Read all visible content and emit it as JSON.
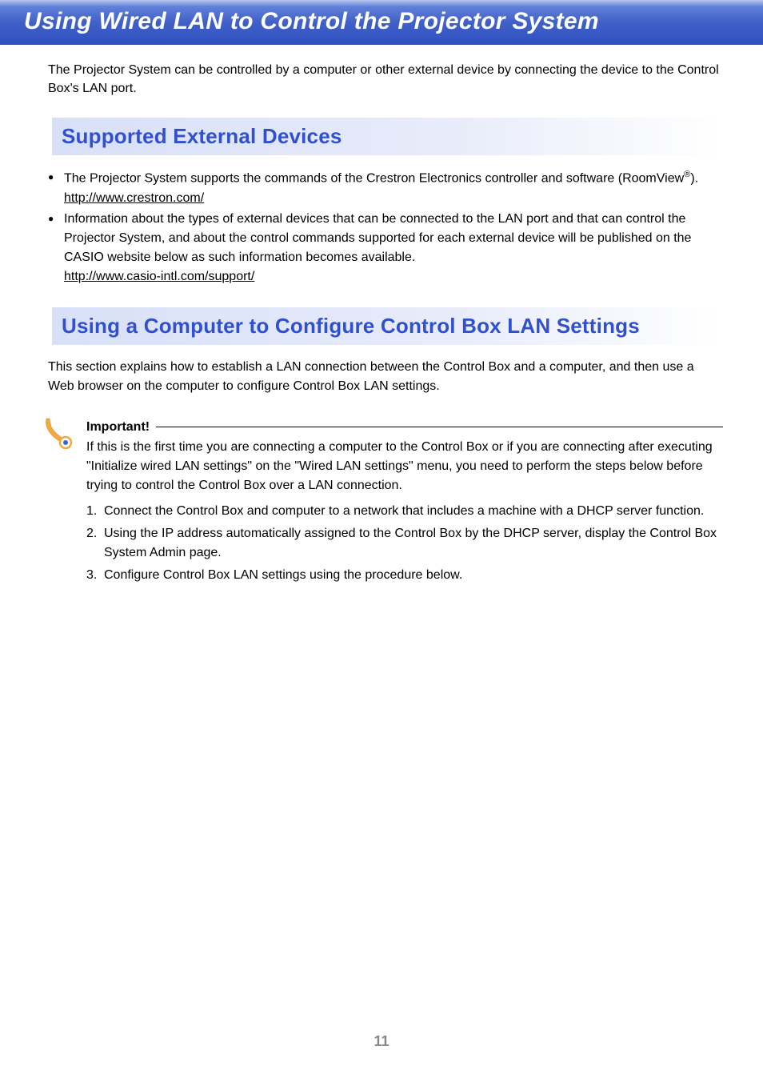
{
  "banner": {
    "title": "Using Wired LAN to Control the Projector System"
  },
  "intro": "The Projector System can be controlled by a computer or other external device by connecting the device to the Control Box's LAN port.",
  "section1": {
    "heading": "Supported External Devices",
    "bullet1_prefix": "The Projector System supports the commands of the Crestron Electronics controller and software (RoomView",
    "bullet1_suffix": ").",
    "bullet1_link": "http://www.crestron.com/",
    "bullet2_text": "Information about the types of external devices that can be connected to the LAN port and that can control the Projector System, and about the control commands supported for each external device will be published on the CASIO website below as such information becomes available.",
    "bullet2_link": "http://www.casio-intl.com/support/"
  },
  "section2": {
    "heading": "Using a Computer to Configure Control Box LAN Settings",
    "intro": "This section explains how to establish a LAN connection between the Control Box and a computer, and then use a Web browser on the computer to configure Control Box LAN settings."
  },
  "important": {
    "label": "Important!",
    "text": "If this is the first time you are connecting a computer to the Control Box or if you are connecting after executing \"Initialize wired LAN settings\" on the \"Wired LAN settings\" menu, you need to perform the steps below before trying to control the Control Box over a LAN connection.",
    "step1": "Connect the Control Box and computer to a network that includes a machine with a DHCP server function.",
    "step2": "Using the IP address automatically assigned to the Control Box by the DHCP server, display the Control Box System Admin page.",
    "step3": "Configure Control Box LAN settings using the procedure below."
  },
  "page_number": "11"
}
